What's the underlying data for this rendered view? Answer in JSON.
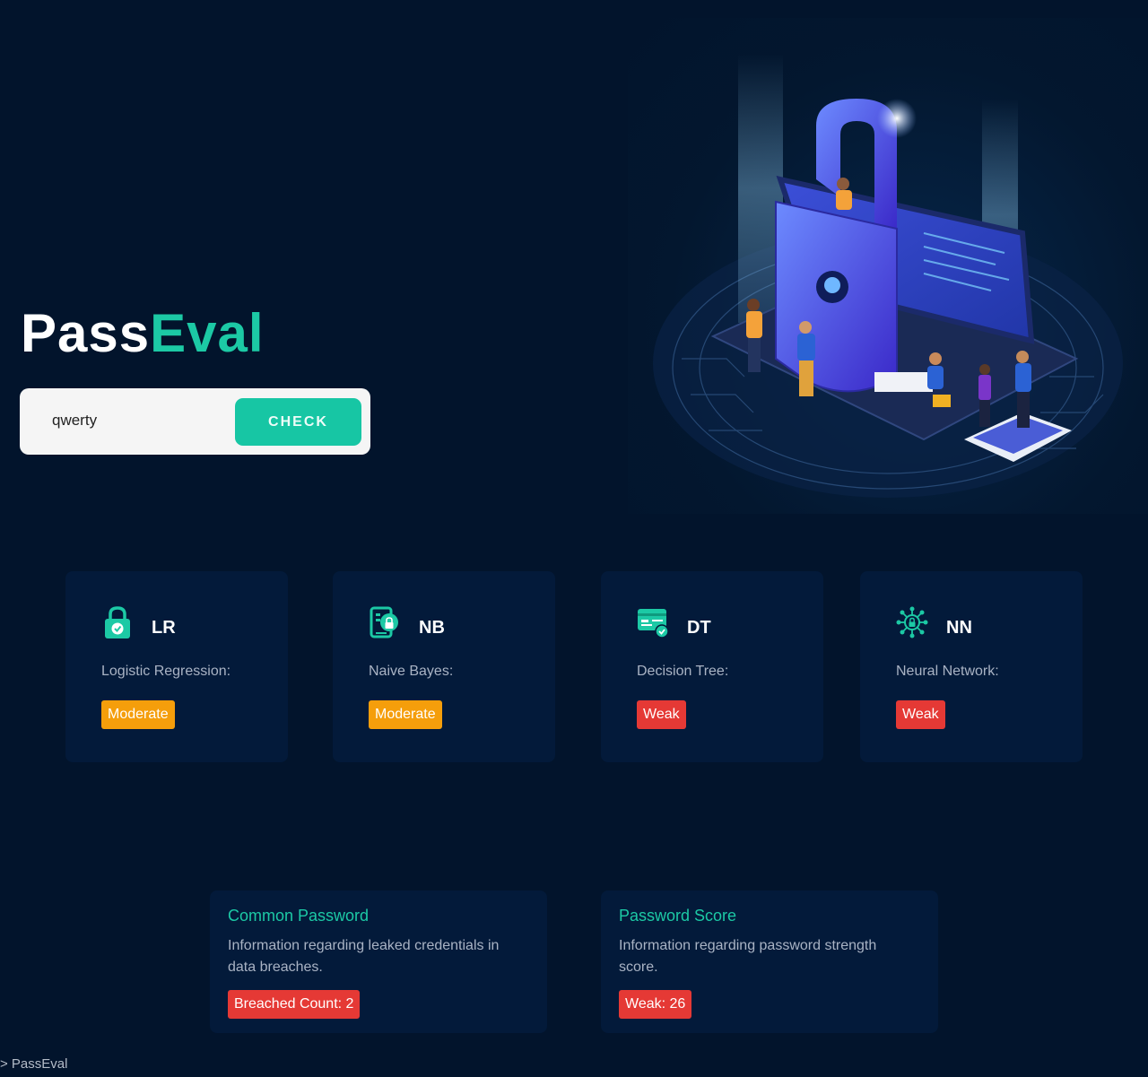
{
  "brand": {
    "part1": "Pass",
    "part2": "Eval"
  },
  "search": {
    "value": "qwerty",
    "placeholder": "",
    "button_label": "CHECK"
  },
  "models": [
    {
      "abbr": "LR",
      "name": "Logistic Regression:",
      "result": "Moderate",
      "level": "moderate",
      "icon": "lock-check-icon"
    },
    {
      "abbr": "NB",
      "name": "Naive Bayes:",
      "result": "Moderate",
      "level": "moderate",
      "icon": "phone-lock-icon"
    },
    {
      "abbr": "DT",
      "name": "Decision Tree:",
      "result": "Weak",
      "level": "weak",
      "icon": "credential-card-icon"
    },
    {
      "abbr": "NN",
      "name": "Neural Network:",
      "result": "Weak",
      "level": "weak",
      "icon": "network-lock-icon"
    }
  ],
  "info": {
    "common": {
      "title": "Common Password",
      "description": "Information regarding leaked credentials in data breaches.",
      "badge": "Breached Count: 2"
    },
    "score": {
      "title": "Password Score",
      "description": "Information regarding password strength score.",
      "badge": "Weak: 26"
    }
  },
  "footer": "> PassEval",
  "colors": {
    "accent": "#1cc9a5",
    "moderate": "#f59e0b",
    "weak": "#e53935",
    "background": "#02142c"
  }
}
